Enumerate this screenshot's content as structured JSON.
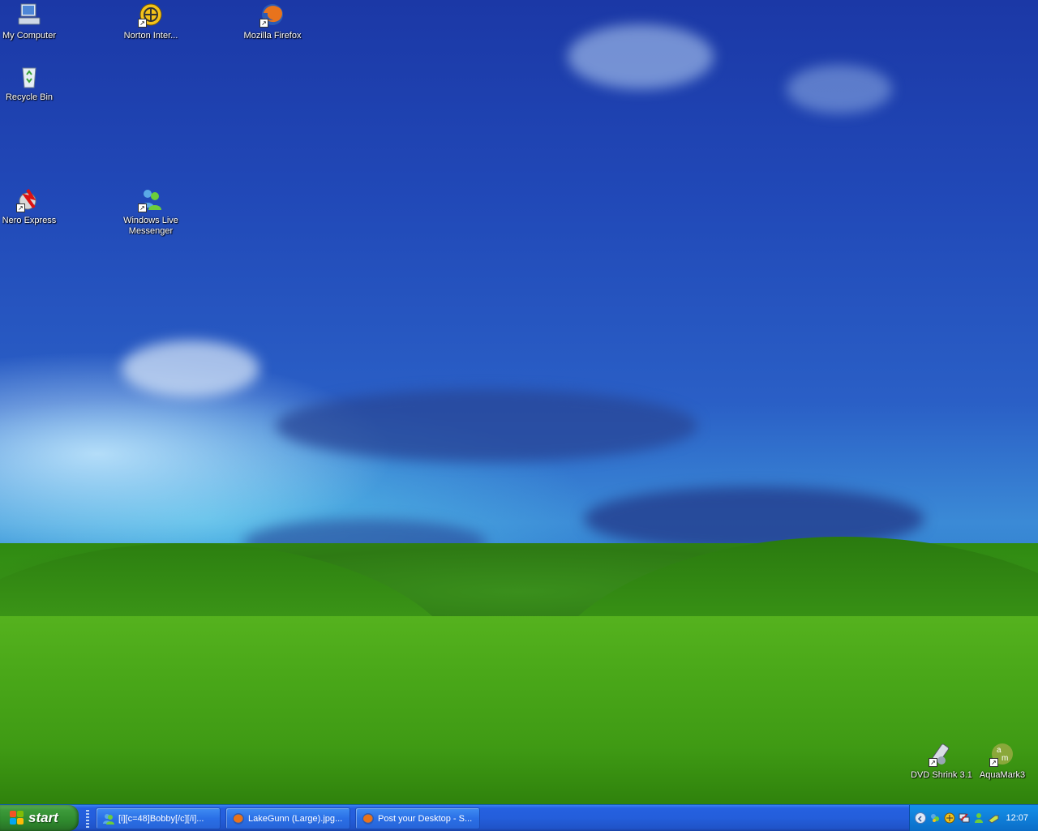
{
  "desktop": {
    "icons": [
      {
        "label": "My Computer",
        "icon": "my-computer-icon"
      },
      {
        "label": "Norton Inter...",
        "icon": "norton-internet-security-icon"
      },
      {
        "label": "Mozilla Firefox",
        "icon": "firefox-icon"
      },
      {
        "label": "Recycle Bin",
        "icon": "recycle-bin-icon"
      },
      {
        "label": "Nero Express",
        "icon": "nero-express-icon"
      },
      {
        "label": "Windows Live Messenger",
        "icon": "windows-live-messenger-icon"
      },
      {
        "label": "DVD Shrink 3.1",
        "icon": "dvd-shrink-icon"
      },
      {
        "label": "AquaMark3",
        "icon": "aquamark3-icon"
      }
    ]
  },
  "taskbar": {
    "start_label": "start",
    "tasks": [
      {
        "label": "[i][c=48]Bobby[/c][/i]...",
        "icon": "messenger-icon"
      },
      {
        "label": "LakeGunn (Large).jpg...",
        "icon": "firefox-icon"
      },
      {
        "label": "Post your Desktop - S...",
        "icon": "firefox-icon"
      }
    ],
    "tray": {
      "icons": [
        "show-hidden-icons-arrow",
        "messenger-tray-icon",
        "norton-tray-icon",
        "network-tray-icon",
        "messenger-status-icon",
        "safely-remove-hardware-icon"
      ],
      "clock": "12:07"
    }
  },
  "colors": {
    "taskbar_blue": "#245edb",
    "start_green": "#3c9a3a",
    "tray_blue": "#0f7fd9"
  }
}
